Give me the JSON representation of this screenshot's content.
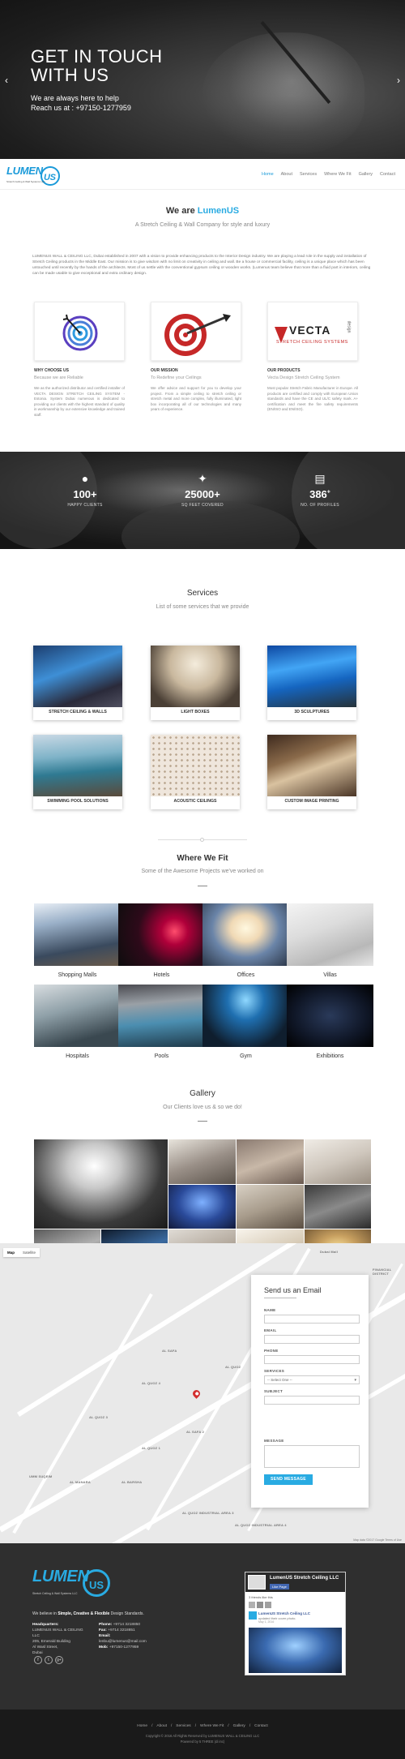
{
  "hero": {
    "title": "GET IN TOUCH WITH US",
    "line1": "We are always here to help",
    "line2": "Reach us at : +97150-1277959"
  },
  "brand": {
    "logo_word": "LUMEN",
    "logo_word2": "US",
    "logo_tag": "Stretch Ceiling & Wall Systems LLC"
  },
  "nav": {
    "items": [
      "Home",
      "About",
      "Services",
      "Where We Fit",
      "Gallery",
      "Contact"
    ]
  },
  "about": {
    "title_prefix": "We are ",
    "title_brand": "LumenUS",
    "subtitle": "A Stretch Ceiling & Wall Company for style and luxury",
    "body": "LUMENUS WALL & CEILING LLC, Dubai established in 2007 with a vision to provide enhancing products to the Interior Design industry. We are playing a lead role in the supply and installation of Stretch Ceiling products in the Middle East. Our mission is to give wisdom with no limit on creativity in ceiling and wall. Be a house or commercial facility, ceiling is a unique place which has been untouched until recently by the hands of the architects. Most of us settle with the conventional gypsum ceiling or wooden works. (Lumenus team believe that more than a fluid part in interiors, ceiling can be made usable to give exceptional and extra ordinary design."
  },
  "features": [
    {
      "heading": "WHY CHOOSE US",
      "sub": "Because we are Reliable",
      "body": "We as the authorized distributor and certified installer of VECTA DESIGN STRETCH CEILING SYSTEM - Estonia. System Dubai numerous is dedicated to providing our clients with the highest standard of quality in workmanship by our extensive knowledge and trained staff."
    },
    {
      "heading": "OUR MISSION",
      "sub": "To Redefine your Ceilings",
      "body": "We offer advice and support for you to develop your project. From a simple ceiling to stretch ceiling or stretch metal and more complex, fully illuminated, light box incorporating all of our technologies and many years of experience."
    },
    {
      "heading": "OUR PRODUCTS",
      "sub": "Vecta Design Stretch Ceiling System",
      "body": "Most popular Stretch Fabric Manufacturer in Europe. All products are certified and comply with European Union standards and have the CE and UL/C safety mark. A+ certification and meet the fire safety requirements (EN/ISO and EN/ISO)."
    }
  ],
  "vecta": {
    "brand": "VECTA",
    "design": "design",
    "tag": "STRETCH CEILING SYSTEMS"
  },
  "stats": [
    {
      "icon": "person-icon",
      "value": "100+",
      "label": "HAPPY CLIENTS"
    },
    {
      "icon": "magic-wand-icon",
      "value": "25000+",
      "label": "SQ FEET COVERED"
    },
    {
      "icon": "server-icon",
      "value": "386",
      "sup": "+",
      "label": "NO. OF PROFILES"
    }
  ],
  "services": {
    "title": "Services",
    "subtitle": "List of some services that we provide",
    "items": [
      "STRETCH CEILING & WALLS",
      "LIGHT BOXES",
      "3D SCULPTURES",
      "SWIMMING POOL SOLUTIONS",
      "ACOUSTIC CEILINGS",
      "CUSTOM IMAGE PRINTING"
    ]
  },
  "fit": {
    "title": "Where We Fit",
    "subtitle": "Some of the Awesome Projects we've worked on",
    "items": [
      "Shopping Malls",
      "Hotels",
      "Offices",
      "Villas",
      "Hospitals",
      "Pools",
      "Gym",
      "Exhibitions"
    ]
  },
  "gallery": {
    "title": "Gallery",
    "subtitle": "Our Clients love us & so we do!"
  },
  "map": {
    "toggle": [
      "Map",
      "Satellite"
    ],
    "labels": [
      "AL SAFA",
      "AL QUOZ",
      "AL QUOZ 4",
      "AL QUOZ 3",
      "AL QUOZ 1",
      "UMM SUQEIM",
      "AL MANARA",
      "AL BARSHA",
      "AL SAFA 2",
      "Dubai Mall",
      "FINANCIAL DISTRICT",
      "AL QUOZ INDUSTRIAL AREA 3",
      "AL QUOZ INDUSTRIAL AREA 4"
    ],
    "footer": "Map data ©2017 Google    Terms of Use"
  },
  "form": {
    "title": "Send us an Email",
    "fields": [
      "NAME",
      "EMAIL",
      "PHONE",
      "SERVICES",
      "SUBJECT",
      "MESSAGE"
    ],
    "select_placeholder": "-- Select One --",
    "button": "SEND MESSAGE"
  },
  "footer": {
    "tagline_prefix": "We believe in ",
    "tagline_bold": "Simple, Creative & Flexible",
    "tagline_suffix": " Design Standards.",
    "hq_label": "Headquarters:",
    "hq_lines": [
      "LUMENUS WALL & CEILING",
      "LLC",
      "205, Emerald Building",
      "Al Wasl Street,",
      "Dubai"
    ],
    "phone_label": "Phone:",
    "phone": "+9714 3218850",
    "fax_label": "Fax:",
    "fax": "+9714 3218851",
    "email_label": "Email:",
    "email": "lenbu@lumenus@mail.com",
    "mob_label": "Mob:",
    "mob": "+97150-1277959",
    "social": [
      "f",
      "t",
      "g+"
    ],
    "fb": {
      "name": "LumenUS Stretch Ceiling LLC",
      "like": "Like Page",
      "friends": "3 friends like this",
      "post_name": "LumenUS Stretch Ceiling LLC",
      "post_sub": "updated their cover photo.",
      "post_date": "May 1, 2016"
    }
  },
  "bottom": {
    "links": [
      "Home",
      "/",
      "About",
      "/",
      "Services",
      "/",
      "Where We Fit",
      "/",
      "Gallery",
      "/",
      "Contact"
    ],
    "copy": "Copyright © 2016 All Rights Reserved by LUMENUS WALL & CEILING LLC",
    "powered": "Powered by 5 THREE (di inc)"
  }
}
